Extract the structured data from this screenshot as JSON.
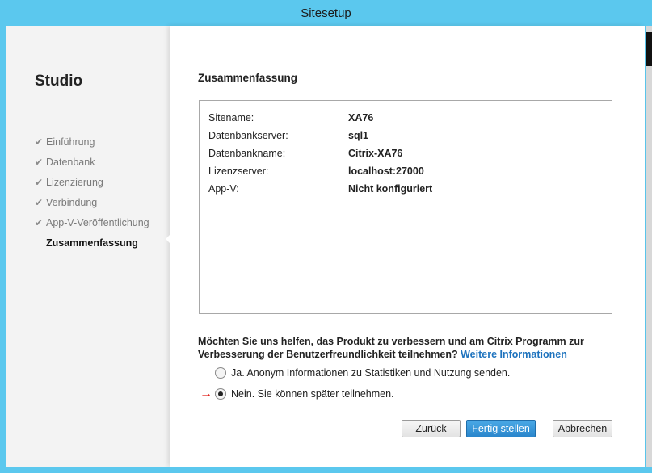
{
  "window": {
    "title": "Sitesetup"
  },
  "sidebar": {
    "app_title": "Studio",
    "steps": [
      {
        "label": "Einführung",
        "done": true
      },
      {
        "label": "Datenbank",
        "done": true
      },
      {
        "label": "Lizenzierung",
        "done": true
      },
      {
        "label": "Verbindung",
        "done": true
      },
      {
        "label": "App-V-Veröffentlichung",
        "done": true
      },
      {
        "label": "Zusammenfassung",
        "done": false,
        "active": true
      }
    ]
  },
  "main": {
    "heading": "Zusammenfassung",
    "summary": [
      {
        "key": "Sitename:",
        "value": "XA76"
      },
      {
        "key": "Datenbankserver:",
        "value": "sql1"
      },
      {
        "key": "Datenbankname:",
        "value": "Citrix-XA76"
      },
      {
        "key": "Lizenzserver:",
        "value": "localhost:27000"
      },
      {
        "key": "App-V:",
        "value": "Nicht konfiguriert"
      }
    ],
    "question": "Möchten Sie uns helfen, das Produkt zu verbessern und am Citrix Programm zur Verbesserung der Benutzerfreundlichkeit teilnehmen?",
    "more_info_link": "Weitere Informationen",
    "options": [
      {
        "label": "Ja. Anonym Informationen zu Statistiken und Nutzung senden.",
        "selected": false
      },
      {
        "label": "Nein. Sie können später teilnehmen.",
        "selected": true
      }
    ]
  },
  "buttons": {
    "back": "Zurück",
    "finish": "Fertig stellen",
    "cancel": "Abbrechen"
  },
  "colors": {
    "titlebar": "#5bc8ee",
    "primary_button": "#2a86cc",
    "link": "#1e73be",
    "annotation_arrow": "#e0201b"
  }
}
